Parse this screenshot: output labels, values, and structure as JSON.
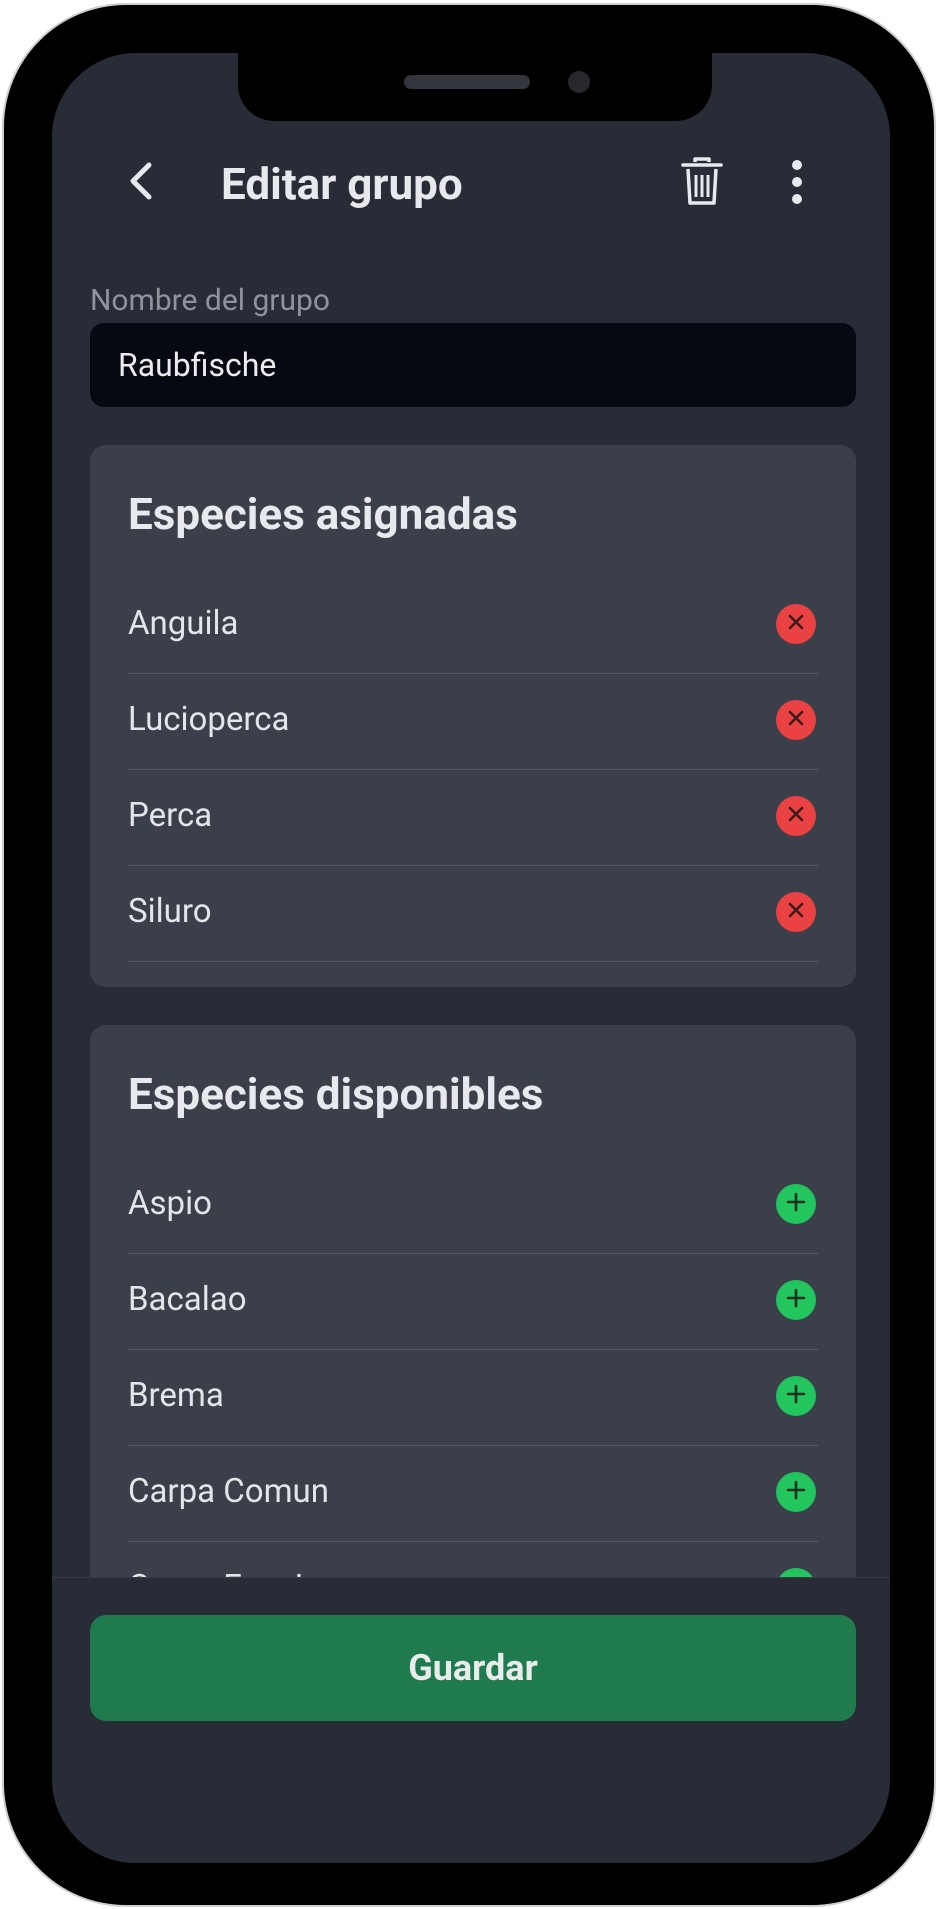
{
  "header": {
    "title": "Editar grupo",
    "back_icon": "chevron-left-icon",
    "trash_icon": "trash-icon",
    "more_icon": "more-vertical-icon"
  },
  "group_name": {
    "label": "Nombre del grupo",
    "value": "Raubfische"
  },
  "assigned": {
    "title": "Especies asignadas",
    "items": [
      {
        "label": "Anguila",
        "action_icon": "remove-icon"
      },
      {
        "label": "Lucioperca",
        "action_icon": "remove-icon"
      },
      {
        "label": "Perca",
        "action_icon": "remove-icon"
      },
      {
        "label": "Siluro",
        "action_icon": "remove-icon"
      }
    ]
  },
  "available": {
    "title": "Especies disponibles",
    "items": [
      {
        "label": "Aspio",
        "action_icon": "add-icon"
      },
      {
        "label": "Bacalao",
        "action_icon": "add-icon"
      },
      {
        "label": "Brema",
        "action_icon": "add-icon"
      },
      {
        "label": "Carpa Comun",
        "action_icon": "add-icon"
      },
      {
        "label": "Carpa Espejo",
        "action_icon": "add-icon"
      }
    ]
  },
  "footer": {
    "save_label": "Guardar"
  },
  "colors": {
    "background": "#282c36",
    "card": "#3a3f4a",
    "input_bg": "#060812",
    "remove": "#ea4242",
    "add": "#22c55e",
    "save_button": "#1f7a4e"
  }
}
